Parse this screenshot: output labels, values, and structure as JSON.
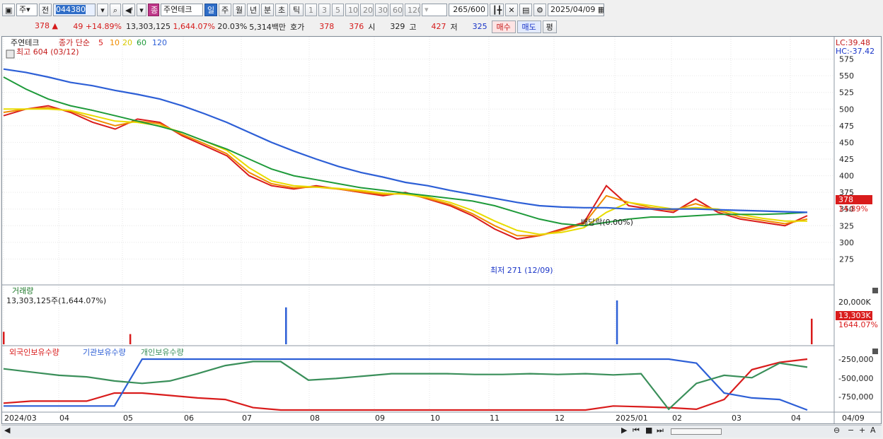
{
  "toolbar": {
    "period_select": "주",
    "prev_label": "전",
    "stock_code": "044380",
    "stock_badge": "종",
    "stock_name": "주연테크",
    "period_tabs": [
      "일",
      "주",
      "월",
      "년",
      "분",
      "초",
      "틱"
    ],
    "num_tabs": [
      "1",
      "3",
      "5",
      "10",
      "20",
      "30",
      "60",
      "120"
    ],
    "count_text": "265",
    "count_max": "/600",
    "date": "2025/04/09"
  },
  "quote": {
    "price": "378",
    "arrow": "▲",
    "change": "49",
    "change_pct": "+14.89%",
    "volume": "13,303,125",
    "volume_pct": "1,644.07%",
    "turnover": "20.03%",
    "amount": "5,314백만",
    "ask_label": "호가",
    "ask1": "378",
    "ask2": "376",
    "open_label": "시",
    "open": "329",
    "high_label": "고",
    "high": "427",
    "low_label": "저",
    "low": "325",
    "buy_label": "매수",
    "sell_label": "매도",
    "avg_label": "평"
  },
  "price_panel": {
    "name": "주연테크",
    "ma_label": "종가 단순",
    "ma_periods": [
      "5",
      "10",
      "20",
      "60",
      "120"
    ],
    "ma_colors": [
      "#d91c1c",
      "#f08c00",
      "#e8dc00",
      "#1e9a3a",
      "#2d5fd6"
    ],
    "high_note": "최고 604 (03/12)",
    "low_note": "최저 271 (12/09)",
    "dividend_note": "배당락(0.00%)",
    "lc": "LC:39.48",
    "hc": "HC:-37.42",
    "last_price": "378",
    "last_pct": "14.89%",
    "y_ticks": [
      "575",
      "550",
      "525",
      "500",
      "475",
      "450",
      "425",
      "400",
      "375",
      "350",
      "325",
      "300",
      "275"
    ]
  },
  "volume_panel": {
    "title": "거래량",
    "value": "13,303,125주(1,644.07%)",
    "y_tick": "20,000K",
    "last_value": "13,303K",
    "last_pct": "1644.07%"
  },
  "holdings_panel": {
    "legend": [
      "외국인보유수량",
      "기관보유수량",
      "개인보유수량"
    ],
    "colors": [
      "#d91c1c",
      "#2d5fd6",
      "#3a8f5a"
    ],
    "y_ticks": [
      "-250,000",
      "-500,000",
      "-750,000"
    ]
  },
  "x_axis": [
    "2024/03",
    "04",
    "05",
    "06",
    "07",
    "08",
    "09",
    "10",
    "11",
    "12",
    "2025/01",
    "02",
    "03",
    "04",
    "04/09"
  ],
  "chart_data": {
    "type": "line",
    "series": [
      {
        "name": "5",
        "values": [
          490,
          500,
          505,
          495,
          480,
          470,
          485,
          480,
          460,
          445,
          430,
          400,
          385,
          380,
          385,
          380,
          375,
          370,
          375,
          365,
          355,
          340,
          320,
          305,
          310,
          320,
          330,
          385,
          355,
          350,
          345,
          365,
          345,
          335,
          330,
          325,
          340
        ]
      },
      {
        "name": "10",
        "values": [
          495,
          500,
          502,
          497,
          485,
          475,
          482,
          478,
          462,
          448,
          433,
          405,
          388,
          382,
          383,
          380,
          376,
          372,
          373,
          366,
          357,
          343,
          325,
          310,
          310,
          318,
          328,
          370,
          360,
          352,
          348,
          358,
          348,
          338,
          333,
          328,
          335
        ]
      },
      {
        "name": "20",
        "values": [
          500,
          500,
          500,
          498,
          490,
          482,
          480,
          475,
          465,
          452,
          438,
          412,
          392,
          385,
          383,
          381,
          378,
          374,
          372,
          368,
          360,
          348,
          332,
          318,
          312,
          315,
          322,
          345,
          360,
          355,
          350,
          352,
          350,
          342,
          336,
          332,
          332
        ]
      },
      {
        "name": "60",
        "values": [
          548,
          530,
          515,
          505,
          498,
          490,
          482,
          474,
          465,
          452,
          440,
          425,
          410,
          400,
          394,
          388,
          382,
          378,
          374,
          370,
          366,
          362,
          355,
          345,
          335,
          328,
          325,
          330,
          335,
          338,
          338,
          340,
          342,
          342,
          342,
          343,
          345
        ]
      },
      {
        "name": "120",
        "values": [
          560,
          555,
          548,
          540,
          535,
          528,
          522,
          515,
          505,
          493,
          480,
          465,
          450,
          437,
          425,
          414,
          405,
          398,
          390,
          385,
          378,
          372,
          366,
          360,
          355,
          353,
          352,
          352,
          350,
          350,
          350,
          350,
          349,
          348,
          347,
          346,
          345
        ]
      }
    ],
    "volume_K": [
      6500,
      0,
      0,
      0,
      0,
      0,
      0,
      0,
      0,
      0,
      0,
      0,
      0,
      5300,
      0,
      0,
      0,
      0,
      0,
      0,
      0,
      0,
      0,
      0,
      0,
      0,
      0,
      0,
      0,
      19200,
      0,
      0,
      0,
      0,
      0,
      0,
      0,
      0,
      0,
      0,
      0,
      0,
      0,
      0,
      0,
      0,
      0,
      0,
      0,
      0,
      0,
      0,
      0,
      0,
      0,
      0,
      0,
      0,
      0,
      0,
      0,
      0,
      0,
      22800,
      0,
      0,
      0,
      0,
      0,
      0,
      0,
      0,
      0,
      0,
      0,
      0,
      0,
      0,
      0,
      0,
      0,
      0,
      0,
      13303
    ],
    "holdings": {
      "foreign": [
        -745000,
        -720000,
        -720000,
        -720000,
        -620000,
        -620000,
        -650000,
        -680000,
        -700000,
        -800000,
        -830000,
        -840000,
        -860000,
        -850000,
        -845000,
        -848000,
        -850000,
        -852000,
        -850000,
        -860000,
        -880000,
        -870000,
        -780000,
        -790000,
        -800000,
        -820000,
        -700000,
        -330000,
        -240000,
        -200000
      ],
      "institution": [
        -780000,
        -780000,
        -780000,
        -780000,
        -780000,
        -200000,
        -200000,
        -200000,
        -200000,
        -200000,
        -200000,
        -200000,
        -200000,
        -200000,
        -200000,
        -200000,
        -200000,
        -200000,
        -200000,
        -200000,
        -200000,
        -200000,
        -200000,
        -200000,
        -200000,
        -250000,
        -620000,
        -680000,
        -700000,
        -890000
      ],
      "individual": [
        -320000,
        -360000,
        -400000,
        -420000,
        -470000,
        -500000,
        -470000,
        -380000,
        -280000,
        -230000,
        -230000,
        -460000,
        -440000,
        -410000,
        -380000,
        -380000,
        -380000,
        -390000,
        -390000,
        -380000,
        -390000,
        -380000,
        -395000,
        -380000,
        -820000,
        -500000,
        -400000,
        -430000,
        -250000,
        -300000
      ]
    }
  }
}
